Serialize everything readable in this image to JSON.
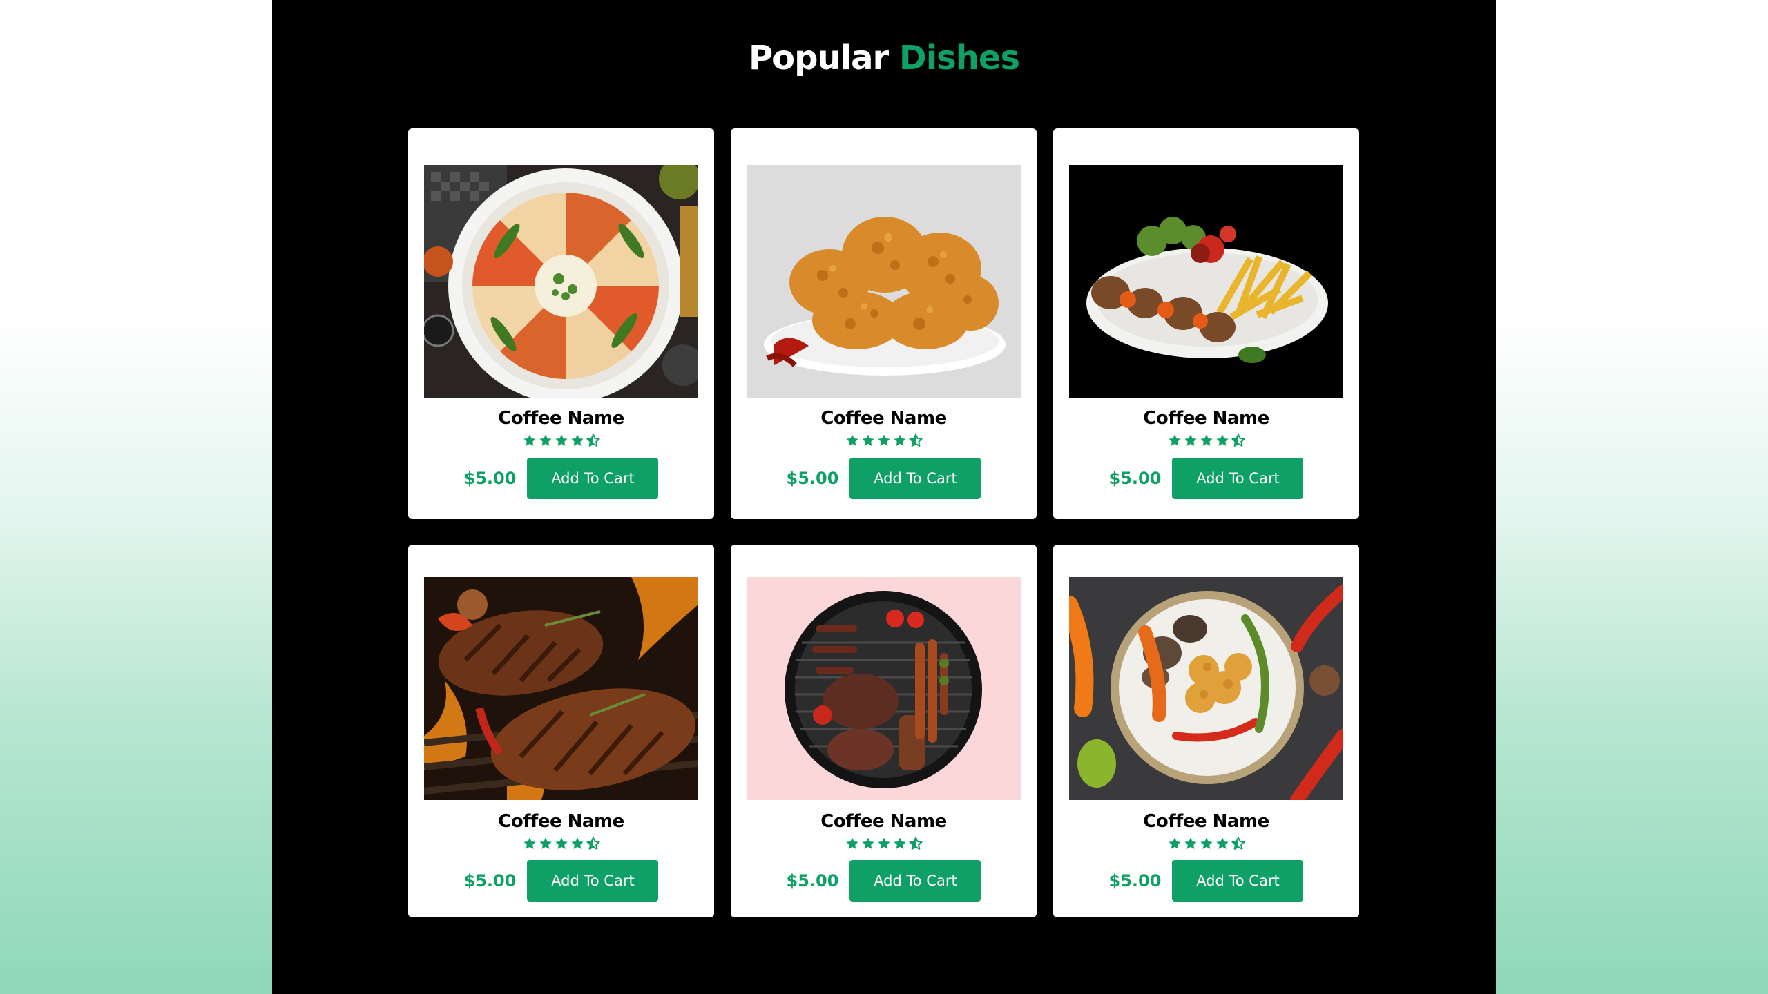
{
  "heading": {
    "part1": "Popular",
    "part2": "Dishes"
  },
  "colors": {
    "accent": "#0ea065",
    "panel": "#000000",
    "card": "#ffffff"
  },
  "dishes": [
    {
      "name": "Coffee Name",
      "rating": 4.5,
      "price": "$5.00",
      "button": "Add To Cart",
      "image": "pizza-platter"
    },
    {
      "name": "Coffee Name",
      "rating": 4.5,
      "price": "$5.00",
      "button": "Add To Cart",
      "image": "fried-chicken"
    },
    {
      "name": "Coffee Name",
      "rating": 4.5,
      "price": "$5.00",
      "button": "Add To Cart",
      "image": "kebab-fries-plate"
    },
    {
      "name": "Coffee Name",
      "rating": 4.5,
      "price": "$5.00",
      "button": "Add To Cart",
      "image": "grilled-steak"
    },
    {
      "name": "Coffee Name",
      "rating": 4.5,
      "price": "$5.00",
      "button": "Add To Cart",
      "image": "bbq-grill"
    },
    {
      "name": "Coffee Name",
      "rating": 4.5,
      "price": "$5.00",
      "button": "Add To Cart",
      "image": "vegetable-plate"
    }
  ]
}
